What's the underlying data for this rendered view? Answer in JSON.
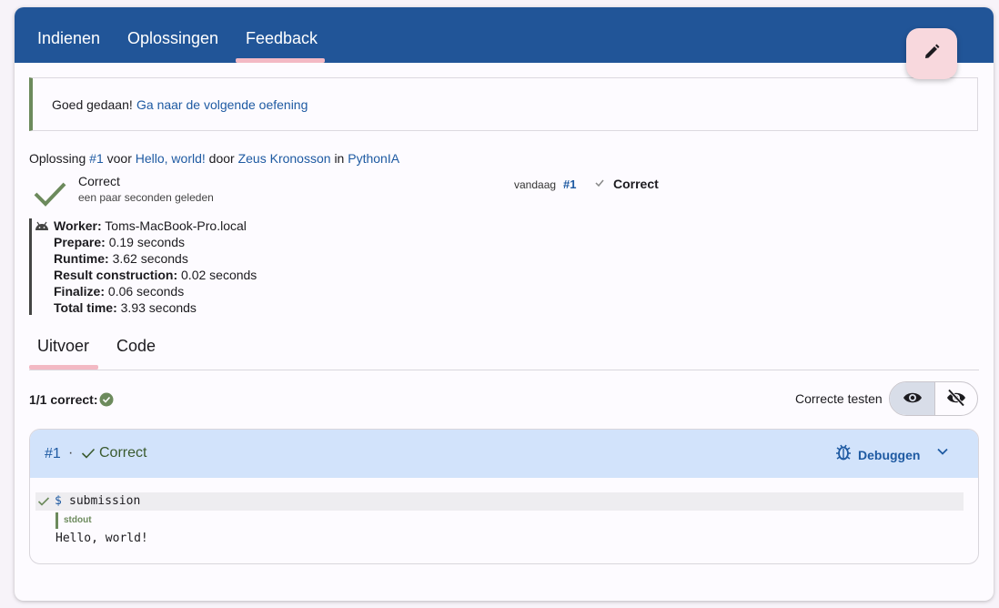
{
  "tabs": {
    "items": [
      "Indienen",
      "Oplossingen",
      "Feedback"
    ],
    "active": "Feedback"
  },
  "alert": {
    "text": "Goed gedaan!",
    "link": "Ga naar de volgende oefening"
  },
  "submission_line": {
    "prefix": "Oplossing",
    "number": "#1",
    "voor": "voor",
    "exercise": "Hello, world!",
    "door": "door",
    "user": "Zeus Kronosson",
    "in": "in",
    "course": "PythonIA"
  },
  "status": {
    "title": "Correct",
    "time": "een paar seconden geleden",
    "icon": "check-icon",
    "color": "#6c8a5c"
  },
  "history": {
    "date": "vandaag",
    "number": "#1",
    "status": "Correct"
  },
  "worker": {
    "icon": "android-icon",
    "lines": [
      {
        "label": "Worker:",
        "value": "Toms-MacBook-Pro.local"
      },
      {
        "label": "Prepare:",
        "value": "0.19 seconds"
      },
      {
        "label": "Runtime:",
        "value": "3.62 seconds"
      },
      {
        "label": "Result construction:",
        "value": "0.02 seconds"
      },
      {
        "label": "Finalize:",
        "value": "0.06 seconds"
      },
      {
        "label": "Total time:",
        "value": "3.93 seconds"
      }
    ]
  },
  "result_tabs": {
    "items": [
      "Uitvoer",
      "Code"
    ],
    "active": "Uitvoer"
  },
  "summary": {
    "correct_count": "1/1 correct:",
    "toggle_label": "Correcte testen"
  },
  "testcase": {
    "number": "#1",
    "separator": "·",
    "status": "Correct",
    "debug_label": "Debuggen",
    "command_prompt": "$",
    "command": "submission",
    "stdout_label": "stdout",
    "stdout": "Hello, world!"
  },
  "colors": {
    "primary": "#215598",
    "link": "#1e5aa2",
    "success": "#6c8a5c",
    "tab_indicator": "#f3b9c4",
    "fab": "#f8d8dd"
  }
}
